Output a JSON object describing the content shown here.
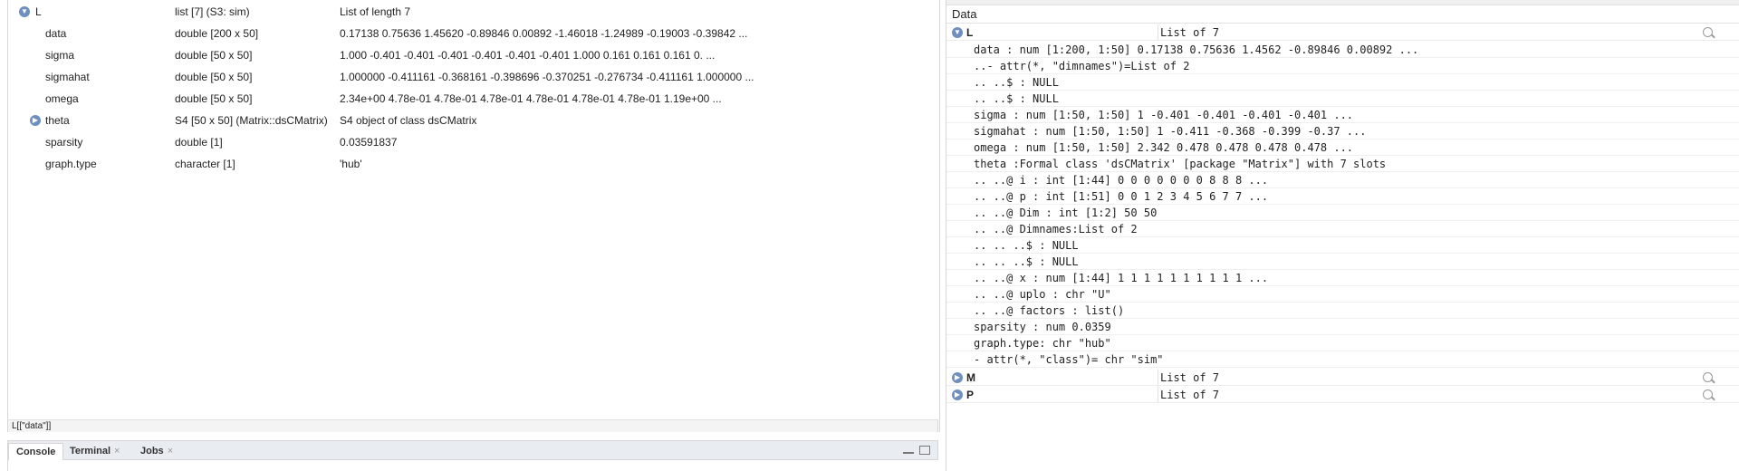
{
  "viewer": {
    "rows": [
      {
        "name": "L",
        "type": "list [7] (S3: sim)",
        "value": "List of length 7",
        "toggle": "expanded",
        "top": true
      },
      {
        "name": "data",
        "type": "double [200 x 50]",
        "value": "0.17138 0.75636 1.45620 -0.89846 0.00892 -1.46018 -1.24989 -0.19003 -0.39842 ..."
      },
      {
        "name": "sigma",
        "type": "double [50 x 50]",
        "value": "1.000 -0.401 -0.401 -0.401 -0.401 -0.401 -0.401 1.000 0.161 0.161 0.161 0. ..."
      },
      {
        "name": "sigmahat",
        "type": "double [50 x 50]",
        "value": "1.000000 -0.411161 -0.368161 -0.398696 -0.370251 -0.276734 -0.411161 1.000000 ..."
      },
      {
        "name": "omega",
        "type": "double [50 x 50]",
        "value": "2.34e+00 4.78e-01 4.78e-01 4.78e-01 4.78e-01 4.78e-01 4.78e-01 1.19e+00 ..."
      },
      {
        "name": "theta",
        "type": "S4 [50 x 50] (Matrix::dsCMatrix)",
        "value": "S4 object of class dsCMatrix",
        "toggle": "collapsed"
      },
      {
        "name": "sparsity",
        "type": "double [1]",
        "value": "0.03591837"
      },
      {
        "name": "graph.type",
        "type": "character [1]",
        "value": "'hub'"
      }
    ],
    "status": "L[[\"data\"]]"
  },
  "console": {
    "tabs": [
      {
        "label": "Console",
        "active": true,
        "closable": false
      },
      {
        "label": "Terminal",
        "active": false,
        "closable": true
      },
      {
        "label": "Jobs",
        "active": false,
        "closable": true
      }
    ]
  },
  "environment": {
    "header": "Data",
    "objects": [
      {
        "name": "L",
        "value": "List of 7",
        "expanded": true
      },
      {
        "name": "M",
        "value": "List of 7",
        "expanded": false
      },
      {
        "name": "P",
        "value": "List of 7",
        "expanded": false
      }
    ],
    "str_lines": [
      "data : num [1:200, 1:50] 0.17138 0.75636 1.4562 -0.89846 0.00892 ...",
      "..- attr(*, \"dimnames\")=List of 2",
      ".. ..$ : NULL",
      ".. ..$ : NULL",
      "sigma : num [1:50, 1:50] 1 -0.401 -0.401 -0.401 -0.401 ...",
      "sigmahat : num [1:50, 1:50] 1 -0.411 -0.368 -0.399 -0.37 ...",
      "omega : num [1:50, 1:50] 2.342 0.478 0.478 0.478 0.478 ...",
      "theta :Formal class 'dsCMatrix' [package \"Matrix\"] with 7 slots",
      ".. ..@ i : int [1:44] 0 0 0 0 0 0 0 8 8 8 ...",
      ".. ..@ p : int [1:51] 0 0 1 2 3 4 5 6 7 7 ...",
      ".. ..@ Dim : int [1:2] 50 50",
      ".. ..@ Dimnames:List of 2",
      ".. .. ..$ : NULL",
      ".. .. ..$ : NULL",
      ".. ..@ x : num [1:44] 1 1 1 1 1 1 1 1 1 1 ...",
      ".. ..@ uplo : chr \"U\"",
      ".. ..@ factors : list()",
      "sparsity : num 0.0359",
      "graph.type: chr \"hub\"",
      "- attr(*, \"class\")= chr \"sim\""
    ]
  },
  "colors": {
    "toggle": "#6f8fbf",
    "border": "#d6d6d6"
  }
}
